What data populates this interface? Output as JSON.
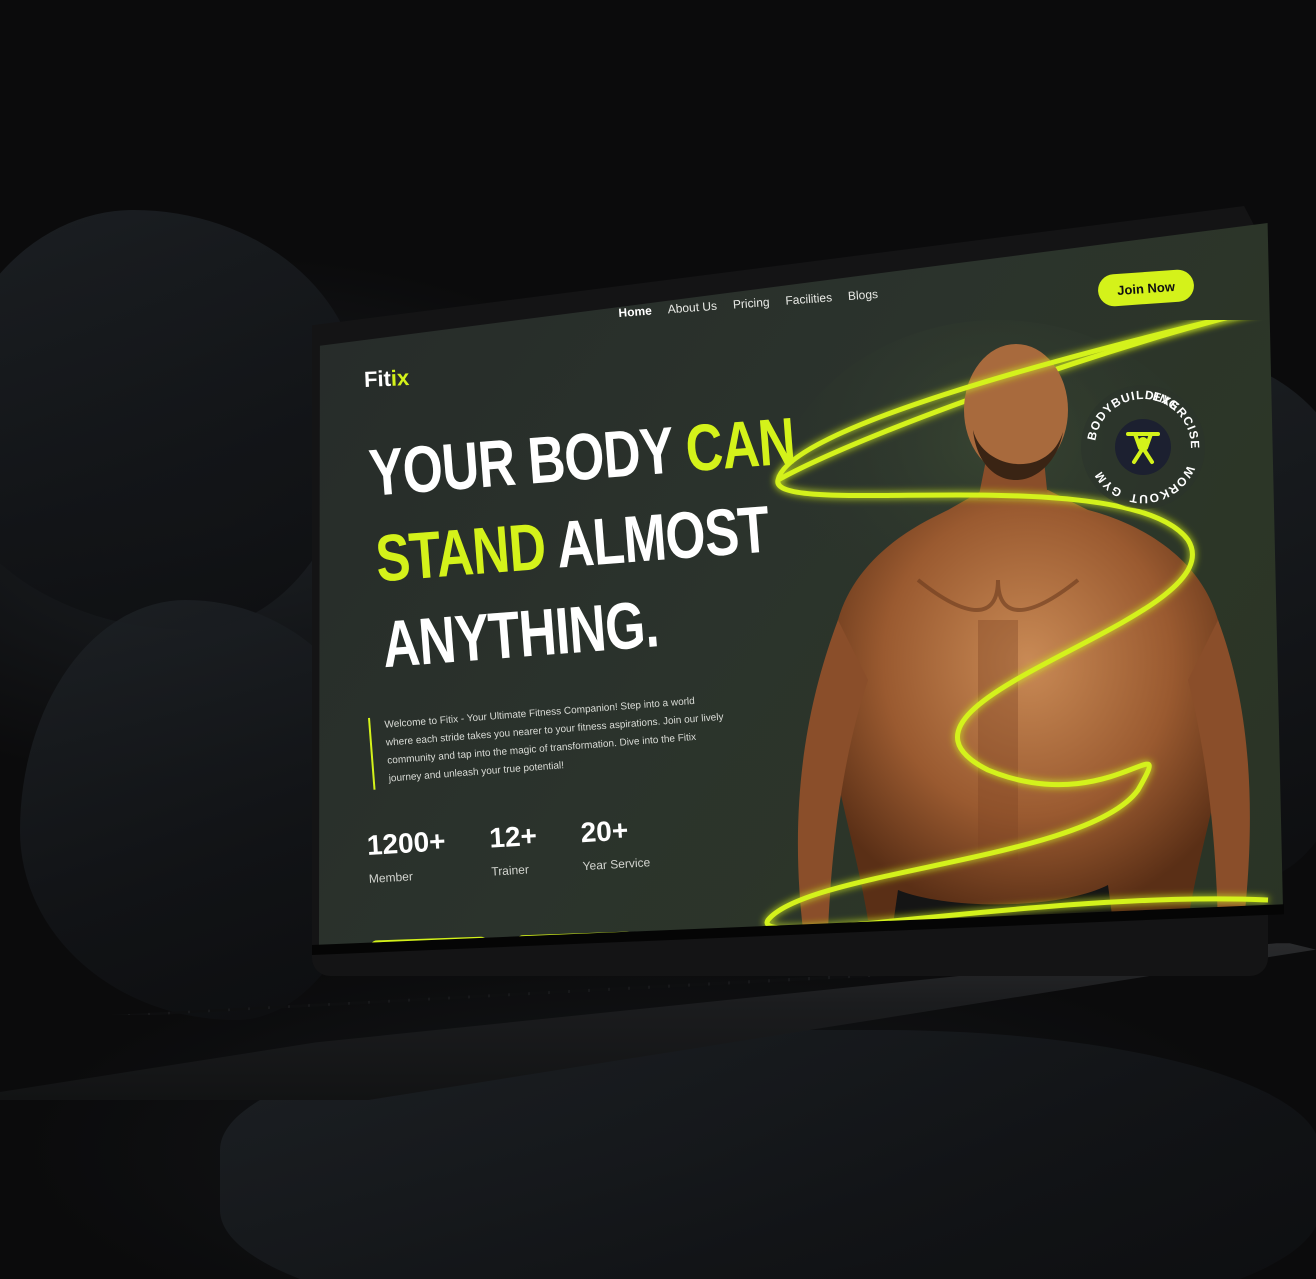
{
  "site": {
    "brand_main": "Fit",
    "brand_accent": "ix",
    "nav": [
      "Home",
      "About Us",
      "Pricing",
      "Facilities",
      "Blogs"
    ],
    "join_button": "Join Now",
    "headline": {
      "line1_a": "YOUR BODY ",
      "line1_b": "CAN",
      "line2_a": "STAND",
      "line2_b": " ALMOST",
      "line3": "ANYTHING."
    },
    "description": "Welcome to Fitix - Your Ultimate Fitness Companion! Step into a world where each stride takes you nearer to your fitness aspirations. Join our lively community and tap into the magic of transformation. Dive into the Fitix journey and unleash your true potential!",
    "stats": [
      {
        "value": "1200+",
        "label": "Member"
      },
      {
        "value": "12+",
        "label": "Trainer"
      },
      {
        "value": "20+",
        "label": "Year Service"
      }
    ],
    "badge": {
      "words": [
        "BODYBUILDING",
        "EXERCISE",
        "WORKOUT",
        "GYM"
      ],
      "icon": "weightlifter-icon"
    }
  },
  "colors": {
    "accent": "#d4f21a",
    "background": "#2b332c",
    "text": "#ffffff"
  }
}
